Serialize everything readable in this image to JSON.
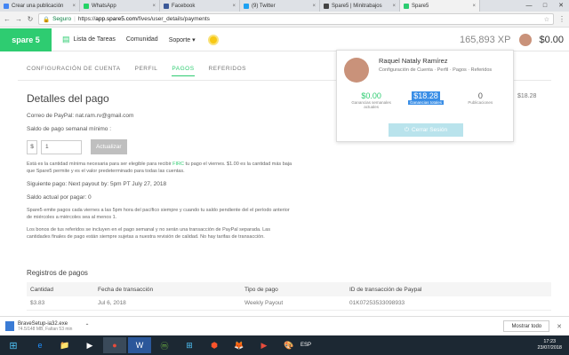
{
  "browser": {
    "tabs": [
      {
        "title": "Crear una publicación",
        "color": "#4285f4",
        "active": false
      },
      {
        "title": "WhatsApp",
        "color": "#25d366",
        "active": false
      },
      {
        "title": "Facebook",
        "color": "#3b5998",
        "active": false
      },
      {
        "title": "(9) Twitter",
        "color": "#1da1f2",
        "active": false
      },
      {
        "title": "Spare5 | Minitrabajos",
        "color": "#444444",
        "active": false
      },
      {
        "title": "Spare5",
        "color": "#2ecc71",
        "active": true
      }
    ],
    "window_controls": [
      "—",
      "□",
      "✕"
    ],
    "secure_label": "Seguro",
    "url_scheme": "https://",
    "url_host": "app.spare5.com",
    "url_path": "/fives/user_details/payments"
  },
  "header": {
    "logo": "spare 5",
    "nav": [
      "Lista de Tareas",
      "Comunidad",
      "Soporte ▾"
    ],
    "xp": "165,893 XP",
    "balance": "$0.00"
  },
  "subnav": [
    "CONFIGURACIÓN DE CUENTA",
    "PERFIL",
    "PAGOS",
    "REFERIDOS"
  ],
  "payments": {
    "title": "Detalles del pago",
    "paypal": "Correo de PayPal: nat.ram.rv@gmail.com",
    "min_label": "Saldo de pago semanal mínimo :",
    "currency": "$",
    "min_value": "1",
    "update_button": "Actualizar",
    "note_pre": "Está es la cantidad mínima necesaria para ser elegible para recibir ",
    "note_link": "FIRC",
    "note_post": " tu pago el viernes. $1.00 es la cantidad más baja que Spare5 permite y es el valor predeterminado para todas las cuentas.",
    "next_payout": "Siguiente pago: Next payout by: 5pm PT July 27, 2018",
    "current_balance": "Saldo actual por pagar: 0",
    "info1": "Spare5 emite pagos cada viernes a las 5pm hora del pacífico siempre y cuando tu saldo pendiente del el período anterior de miércoles a miércoles sea al menos 1.",
    "info2": "Los bonos de tus referidos se incluyen en el pago semanal y no serán una transacción de PayPal separada. Las cantidades finales de pago están siempre sujetas a nuestra revisión de calidad. No hay tarifas de transacción."
  },
  "records": {
    "title": "Registros de pagos",
    "headers": [
      "Cantidad",
      "Fecha de transacción",
      "Tipo de pago",
      "ID de transacción de Paypal"
    ],
    "rows": [
      [
        "$3.83",
        "Jul 6, 2018",
        "Weekly Payout",
        "01K07253533098933"
      ]
    ]
  },
  "popup": {
    "name": "Raquel Nataly Ramírez",
    "links": "Configuración de Cuenta · Perfil · Pagos · Referidos",
    "stats": [
      {
        "value": "$0.00",
        "label": "Ganancias semanales actuales",
        "color": "#2ecc71"
      },
      {
        "value": "$18.28",
        "label": "Ganancias totales",
        "color": "#ffffff"
      },
      {
        "value": "0",
        "label": "Publicaciones",
        "color": "#555555"
      }
    ],
    "logout": "Cerrar Sesión"
  },
  "side_amount": "$18.28",
  "download": {
    "file": "BraveSetup-ia32.exe",
    "status": "74.5/148 MB, Faltan 53 min",
    "show_all": "Mostrar todo"
  },
  "taskbar": {
    "apps": [
      "e",
      "📁",
      "▶",
      "●",
      "W",
      "ⓜ",
      "⊞",
      "⬢",
      "🦊",
      "▶",
      "🎨"
    ],
    "time": "17:23",
    "date": "23/07/2018",
    "tray": "ESP"
  }
}
